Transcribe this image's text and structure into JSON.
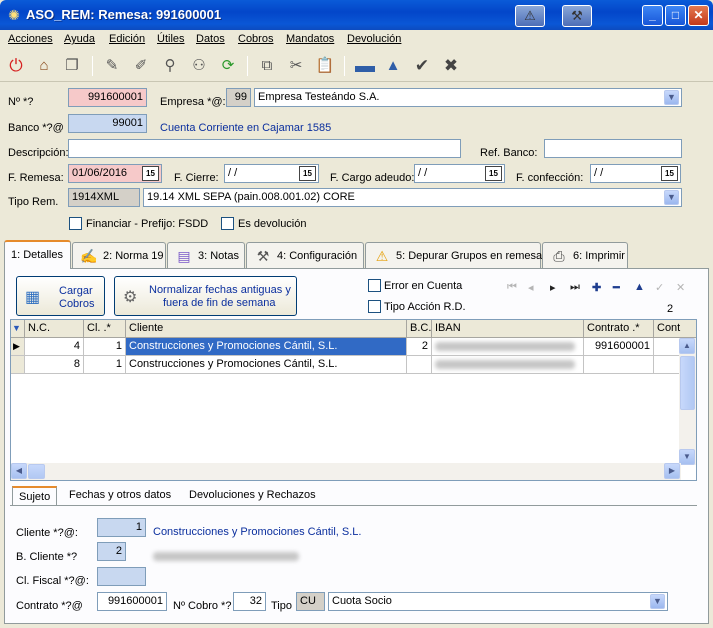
{
  "window": {
    "title": "ASO_REM: Remesa: 991600001"
  },
  "menu": [
    "Acciones",
    "Ayuda",
    "Edición",
    "Útiles",
    "Datos",
    "Cobros",
    "Mandatos",
    "Devolución"
  ],
  "form": {
    "numero_label": "Nº *?",
    "numero_value": "991600001",
    "empresa_label": "Empresa *@:",
    "empresa_code": "99",
    "empresa_name": "Empresa Testeándo S.A.",
    "banco_label": "Banco *?@",
    "banco_code": "99001",
    "banco_desc": "Cuenta Corriente en Cajamar 1585",
    "descripcion_label": "Descripción:",
    "descripcion_value": "",
    "ref_banco_label": "Ref. Banco:",
    "ref_banco_value": "",
    "f_remesa_label": "F. Remesa:",
    "f_remesa_value": "01/06/2016",
    "f_cierre_label": "F. Cierre:",
    "f_cierre_value": " / /",
    "f_cargo_label": "F. Cargo adeudo:",
    "f_cargo_value": " / /",
    "f_confeccion_label": "F. confección:",
    "f_confeccion_value": " / /",
    "cal_icon": "15",
    "tipo_rem_label": "Tipo Rem.",
    "tipo_rem_code": "1914XML",
    "tipo_rem_desc": "19.14 XML SEPA (pain.008.001.02) CORE",
    "financiar_label": "Financiar - Prefijo: FSDD",
    "devolucion_label": "Es devolución"
  },
  "tabs": [
    {
      "label": "1: Detalles",
      "icon": "none"
    },
    {
      "label": "2: Norma 19",
      "icon": "pencil-icon"
    },
    {
      "label": "3: Notas",
      "icon": "notes-icon"
    },
    {
      "label": "4: Configuración",
      "icon": "tools-icon"
    },
    {
      "label": "5: Depurar Grupos en remesa",
      "icon": "warning-icon"
    },
    {
      "label": "6: Imprimir",
      "icon": "printer-icon"
    }
  ],
  "detalles": {
    "cargar_label_1": "Cargar",
    "cargar_label_2": "Cobros",
    "normalizar_label_1": "Normalizar fechas antiguas y",
    "normalizar_label_2": "fuera de fin de semana",
    "error_cuenta_label": "Error en Cuenta",
    "tipo_accion_label": "Tipo Acción R.D.",
    "record_count": "2"
  },
  "grid": {
    "columns": [
      "N.C.",
      "Cl. .*",
      "Cliente",
      "B.C.",
      "IBAN",
      "Contrato .*",
      "Cont"
    ],
    "rows": [
      {
        "nc": "4",
        "cl": "1",
        "cliente": "Construcciones y Promociones Cántil, S.L.",
        "bc": "2",
        "contrato": "991600001"
      },
      {
        "nc": "8",
        "cl": "1",
        "cliente": "Construcciones y Promociones Cántil, S.L.",
        "bc": "",
        "contrato": ""
      }
    ]
  },
  "subtabs": [
    "Sujeto",
    "Fechas y otros datos",
    "Devoluciones y Rechazos"
  ],
  "sujeto": {
    "cliente_label": "Cliente *?@:",
    "cliente_code": "1",
    "cliente_name": "Construcciones y Promociones Cántil, S.L.",
    "b_cliente_label": "B. Cliente *?",
    "b_cliente_code": "2",
    "cl_fiscal_label": "Cl. Fiscal *?@:",
    "cl_fiscal_value": "",
    "contrato_label": "Contrato *?@",
    "contrato_value": "991600001",
    "n_cobro_label": "Nº Cobro *?",
    "n_cobro_value": "32",
    "tipo_label": "Tipo",
    "tipo_code": "CU",
    "tipo_desc": "Cuota Socio"
  }
}
